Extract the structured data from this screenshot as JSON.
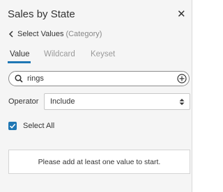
{
  "panel": {
    "title": "Sales by State",
    "close_icon": "close-icon",
    "back_label": "Select Values",
    "back_category": "(Category)",
    "tabs": [
      {
        "label": "Value",
        "active": true
      },
      {
        "label": "Wildcard",
        "active": false
      },
      {
        "label": "Keyset",
        "active": false
      }
    ],
    "search": {
      "value": "rings",
      "icon": "search-icon",
      "add_icon": "plus-circle-icon"
    },
    "operator": {
      "label": "Operator",
      "value": "Include",
      "options": [
        "Include"
      ]
    },
    "select_all": {
      "label": "Select All",
      "checked": true
    },
    "empty_message": "Please add at least one value to start."
  },
  "colors": {
    "accent": "#1f77b4",
    "panel_bg": "#f5f5f5",
    "text": "#333333",
    "muted": "#9a9a9a"
  }
}
